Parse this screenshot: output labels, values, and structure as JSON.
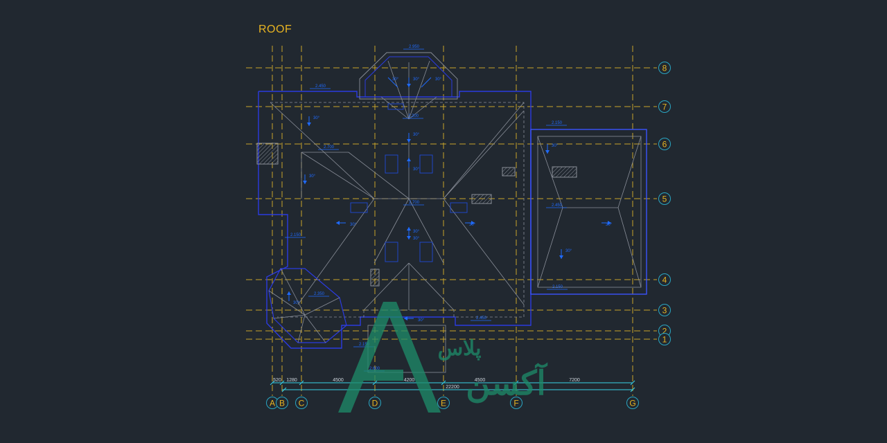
{
  "drawing": {
    "title": "ROOF",
    "colors": {
      "background": "#212830",
      "title": "#e8b422",
      "axis_line": "#c9a52a",
      "axis_label": "#e8b422",
      "bubble": "#2aa7c4",
      "roof_outline": "#2b3be0",
      "roof_lines": "#8a8f99",
      "dim_line": "#39d3e8",
      "annotation": "#1f6bff",
      "logo": "#1e8c6a"
    },
    "grid_rows": [
      "8",
      "7",
      "6",
      "5",
      "4",
      "3",
      "2",
      "1"
    ],
    "grid_columns": [
      "A",
      "B",
      "C",
      "D",
      "E",
      "F",
      "G"
    ],
    "dimensions": [
      "520",
      "1280",
      "4500",
      "4200",
      "4500",
      "7200"
    ],
    "total_dimension": "22200",
    "slope_labels": [
      "30°",
      "30°",
      "30°",
      "30°",
      "30°",
      "30°",
      "30°",
      "30°",
      "30°",
      "30°",
      "30°",
      "30°",
      "30°",
      "30°",
      "30°",
      "30°"
    ],
    "level_labels": [
      "2.950",
      "2.450",
      "2.200",
      "2.700",
      "2.700",
      "2.150",
      "2.350",
      "2.450",
      "2.150",
      "2.450",
      "2.150",
      "2.150",
      "2.600"
    ]
  },
  "watermark": {
    "logo_letter": "A",
    "text_line1": "پلاس",
    "text_line2": "آکسن"
  }
}
